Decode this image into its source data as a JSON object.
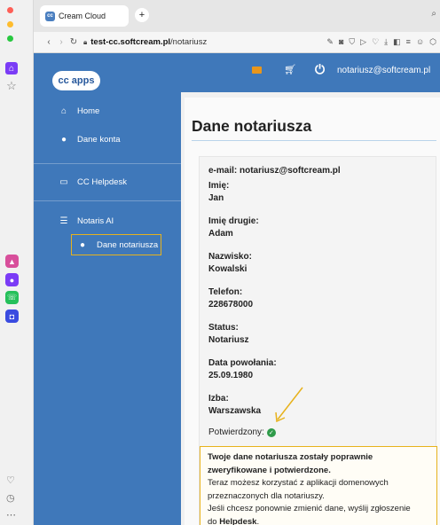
{
  "browser": {
    "tab_title": "Cream Cloud",
    "url_host": "test-cc.softcream.pl",
    "url_path": "/notariusz"
  },
  "app": {
    "logo": "cc apps",
    "user_email": "notariusz@softcream.pl"
  },
  "sidebar": {
    "items": [
      {
        "label": "Home",
        "icon": "home-icon"
      },
      {
        "label": "Dane konta",
        "icon": "user-icon"
      },
      {
        "label": "CC Helpdesk",
        "icon": "monitor-icon"
      },
      {
        "label": "Notaris AI",
        "icon": "list-icon"
      },
      {
        "label": "Dane notariusza",
        "icon": "user-icon"
      }
    ]
  },
  "page": {
    "title": "Dane notariusza",
    "email_line": "e-mail: notariusz@softcream.pl",
    "fields": [
      {
        "label": "Imię:",
        "value": "Jan"
      },
      {
        "label": "Imię drugie:",
        "value": "Adam"
      },
      {
        "label": "Nazwisko:",
        "value": "Kowalski"
      },
      {
        "label": "Telefon:",
        "value": "228678000"
      },
      {
        "label": "Status:",
        "value": "Notariusz"
      },
      {
        "label": "Data powołania:",
        "value": "25.09.1980"
      },
      {
        "label": "Izba:",
        "value": "Warszawska"
      }
    ],
    "confirmed_label": "Potwierdzony:",
    "notice": {
      "headline_1": "Twoje dane notariusza zostały poprawnie",
      "headline_2": "zweryfikowane i potwierdzone.",
      "line_1": "Teraz możesz korzystać z aplikacji domenowych",
      "line_2": "przeznaczonych dla notariuszy.",
      "line_3": "Jeśli chcesz ponownie zmienić dane, wyślij zgłoszenie",
      "line_4_prefix": "do ",
      "line_4_link": "Helpdesk",
      "line_4_suffix": "."
    }
  },
  "colors": {
    "sidebar": "#3f78ba",
    "highlight": "#e7b21c",
    "confirmed": "#2f9b4a"
  }
}
